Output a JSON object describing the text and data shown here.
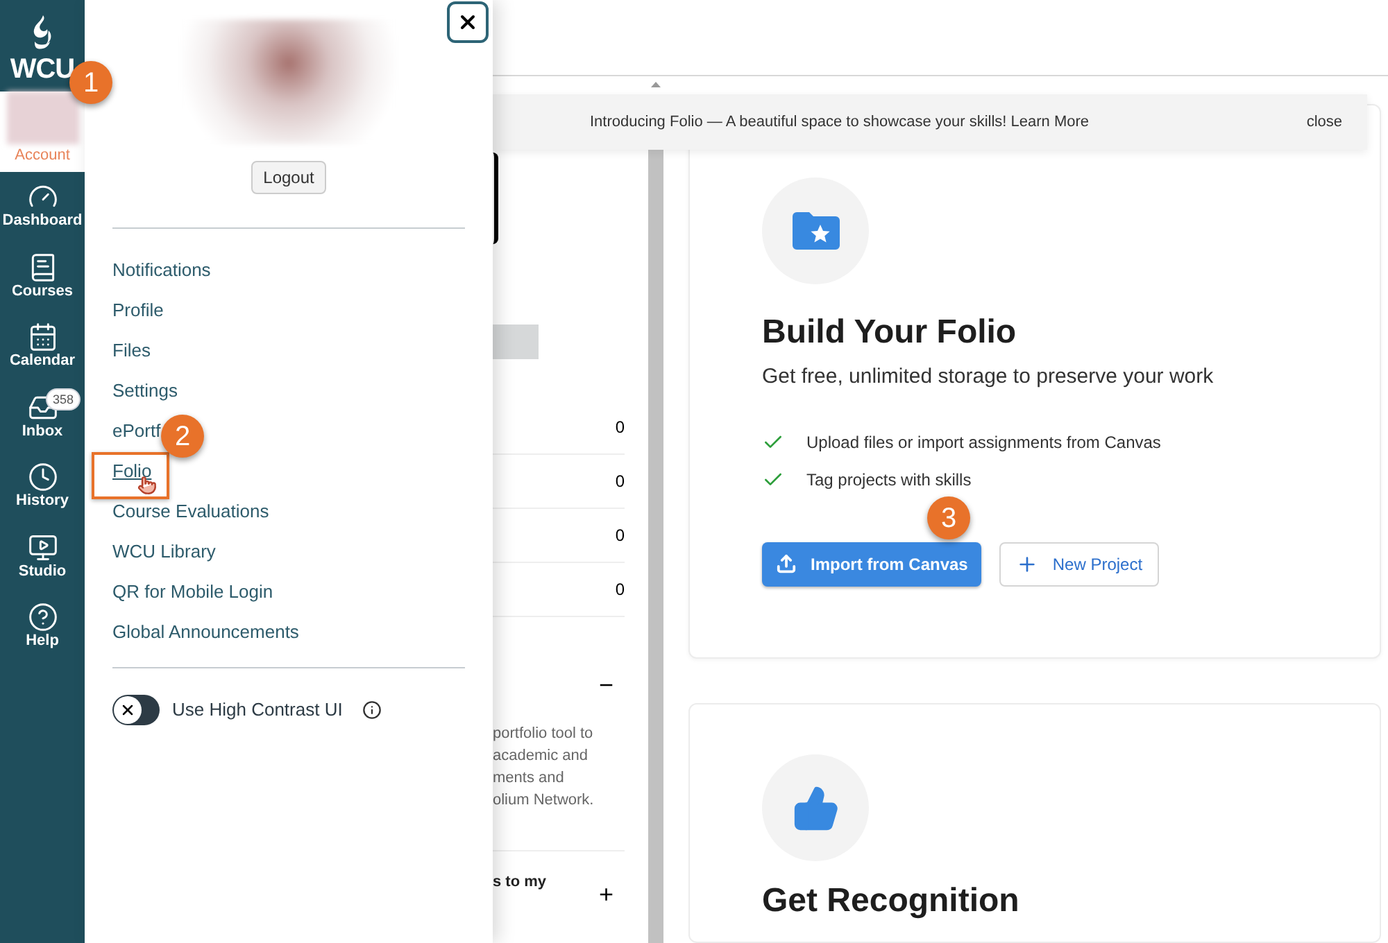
{
  "nav": {
    "logo": "WCU",
    "items": [
      {
        "label": "Account",
        "selected": true
      },
      {
        "label": "Dashboard",
        "selected": false
      },
      {
        "label": "Courses",
        "selected": false
      },
      {
        "label": "Calendar",
        "selected": false
      },
      {
        "label": "Inbox",
        "selected": false,
        "badge": "358"
      },
      {
        "label": "History",
        "selected": false
      },
      {
        "label": "Studio",
        "selected": false
      },
      {
        "label": "Help",
        "selected": false
      }
    ]
  },
  "tray": {
    "logout": "Logout",
    "links": [
      {
        "label": "Notifications",
        "highlighted": false
      },
      {
        "label": "Profile",
        "highlighted": false
      },
      {
        "label": "Files",
        "highlighted": false
      },
      {
        "label": "Settings",
        "highlighted": false
      },
      {
        "label": "ePortf",
        "highlighted": false
      },
      {
        "label": "Folio",
        "highlighted": true
      },
      {
        "label": "Course Evaluations",
        "highlighted": false
      },
      {
        "label": "WCU Library",
        "highlighted": false
      },
      {
        "label": "QR for Mobile Login",
        "highlighted": false
      },
      {
        "label": "Global Announcements",
        "highlighted": false
      }
    ],
    "toggle": {
      "label": "Use High Contrast UI",
      "on": false
    }
  },
  "banner": {
    "message": "Introducing Folio — A beautiful space to showcase your skills!",
    "link": "Learn More",
    "close": "close"
  },
  "background_column": {
    "counts": [
      "0",
      "0",
      "0",
      "0"
    ],
    "collapse": "−",
    "text_lines": [
      "portfolio tool to",
      "academic and",
      "ments and",
      "olium Network."
    ],
    "row_text": "s to my",
    "expand": "+"
  },
  "cards": [
    {
      "title": "Build Your Folio",
      "subtitle": "Get free, unlimited storage to preserve your work",
      "features": [
        "Upload files or import assignments from Canvas",
        "Tag projects with skills"
      ],
      "primary_button": "Import from Canvas",
      "secondary_button": "New Project"
    },
    {
      "title": "Get Recognition"
    }
  ],
  "callouts": [
    "1",
    "2",
    "3"
  ]
}
